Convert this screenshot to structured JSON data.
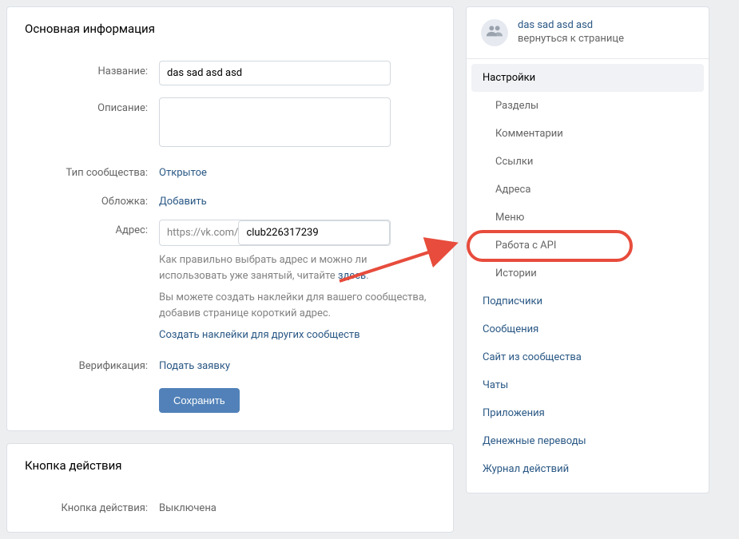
{
  "panel1": {
    "title": "Основная информация",
    "name_label": "Название:",
    "name_value": "das sad asd asd",
    "desc_label": "Описание:",
    "desc_value": "",
    "type_label": "Тип сообщества:",
    "type_value": "Открытое",
    "cover_label": "Обложка:",
    "cover_action": "Добавить",
    "url_label": "Адрес:",
    "url_prefix": "https://vk.com/",
    "url_value": "club226317239",
    "url_help_1a": "Как правильно выбрать адрес и можно ли использовать уже занятый, читайте ",
    "url_help_1b": "здесь",
    "url_help_1c": ".",
    "url_help_2": "Вы можете создать наклейки для вашего сообщества, добавив странице короткий адрес.",
    "url_help_3": "Создать наклейки для других сообществ",
    "verify_label": "Верификация:",
    "verify_action": "Подать заявку",
    "save_btn": "Сохранить"
  },
  "panel2": {
    "title": "Кнопка действия",
    "btn_label": "Кнопка действия:",
    "btn_value": "Выключена"
  },
  "sidebar": {
    "group_name": "das sad asd asd",
    "back_text": "вернуться к странице",
    "nav": [
      {
        "label": "Настройки",
        "level": 1,
        "active": true,
        "highlight": false
      },
      {
        "label": "Разделы",
        "level": 2,
        "active": false,
        "highlight": false
      },
      {
        "label": "Комментарии",
        "level": 2,
        "active": false,
        "highlight": false
      },
      {
        "label": "Ссылки",
        "level": 2,
        "active": false,
        "highlight": false
      },
      {
        "label": "Адреса",
        "level": 2,
        "active": false,
        "highlight": false
      },
      {
        "label": "Меню",
        "level": 2,
        "active": false,
        "highlight": false
      },
      {
        "label": "Работа с API",
        "level": 2,
        "active": false,
        "highlight": true
      },
      {
        "label": "Истории",
        "level": 2,
        "active": false,
        "highlight": false
      },
      {
        "label": "Подписчики",
        "level": 1,
        "active": false,
        "highlight": false
      },
      {
        "label": "Сообщения",
        "level": 1,
        "active": false,
        "highlight": false
      },
      {
        "label": "Сайт из сообщества",
        "level": 1,
        "active": false,
        "highlight": false
      },
      {
        "label": "Чаты",
        "level": 1,
        "active": false,
        "highlight": false
      },
      {
        "label": "Приложения",
        "level": 1,
        "active": false,
        "highlight": false
      },
      {
        "label": "Денежные переводы",
        "level": 1,
        "active": false,
        "highlight": false
      },
      {
        "label": "Журнал действий",
        "level": 1,
        "active": false,
        "highlight": false
      }
    ]
  }
}
